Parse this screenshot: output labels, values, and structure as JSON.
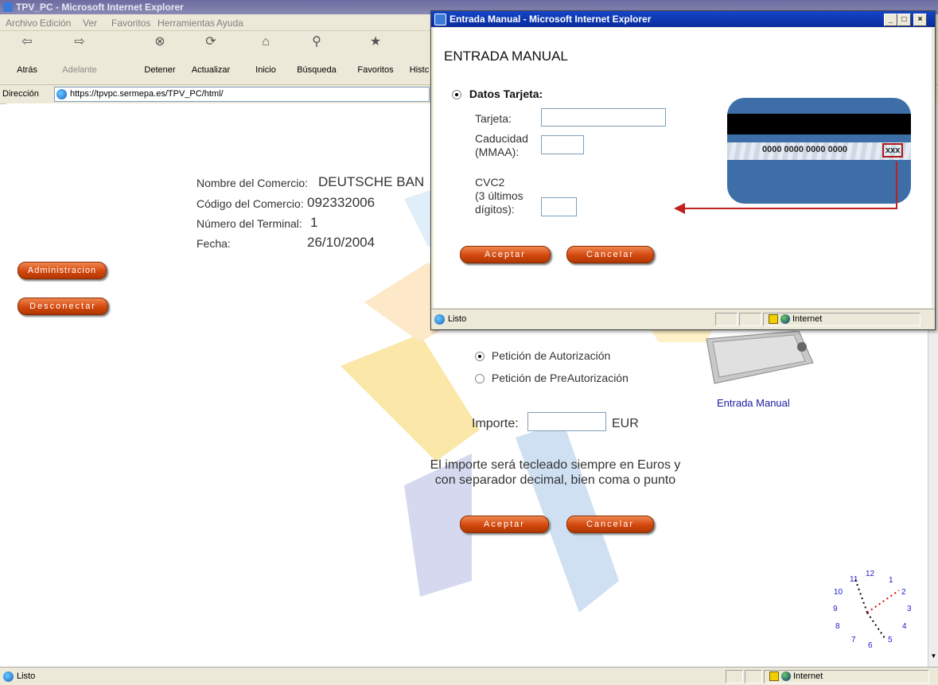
{
  "main_window": {
    "title": "TPV_PC - Microsoft Internet Explorer",
    "menu": [
      "Archivo",
      "Edición",
      "Ver",
      "Favoritos",
      "Herramientas",
      "Ayuda"
    ],
    "toolbar": {
      "back": "Atrás",
      "forward": "Adelante",
      "stop": "Detener",
      "refresh": "Actualizar",
      "home": "Inicio",
      "search": "Búsqueda",
      "favorites": "Favoritos",
      "history": "Histc"
    },
    "address_label": "Dirección",
    "address_url": "https://tpvpc.sermepa.es/TPV_PC/html/",
    "status_text": "Listo",
    "zone": "Internet"
  },
  "page": {
    "merchant_name_label": "Nombre del Comercio:",
    "merchant_name_value": "DEUTSCHE BAN",
    "merchant_code_label": "Código del Comercio:",
    "merchant_code_value": "092332006",
    "terminal_label": "Número del Terminal:",
    "terminal_value": "1",
    "date_label": "Fecha:",
    "date_value": "26/10/2004",
    "admin_button": "Administracion",
    "disconnect_button": "Desconectar",
    "radio_authorization": "Petición de Autorización",
    "radio_preauthorization": "Petición de PreAutorización",
    "amount_label": "Importe:",
    "amount_value": "",
    "currency": "EUR",
    "note_line1": "El importe será tecleado siempre en Euros y",
    "note_line2": "con separador decimal, bien coma o punto",
    "accept_button": "Aceptar",
    "cancel_button": "Cancelar",
    "manual_entry_link": "Entrada Manual",
    "clock_numbers": [
      "12",
      "1",
      "2",
      "3",
      "4",
      "5",
      "6",
      "7",
      "8",
      "9",
      "10",
      "11"
    ]
  },
  "popup": {
    "title": "Entrada Manual - Microsoft Internet Explorer",
    "heading": "ENTRADA MANUAL",
    "section_label": "Datos Tarjeta:",
    "card_label": "Tarjeta:",
    "expiry_label_1": "Caducidad",
    "expiry_label_2": "(MMAA):",
    "cvc_label_1": "CVC2",
    "cvc_label_2": "(3 últimos",
    "cvc_label_3": "dígitos):",
    "card_value": "",
    "expiry_value": "",
    "cvc_value": "",
    "card_number": "0000 0000 0000 0000",
    "card_cvc_mark": "xxx",
    "accept_button": "Aceptar",
    "cancel_button": "Cancelar",
    "status_text": "Listo",
    "zone": "Internet"
  },
  "colors": {
    "button_orange": "#d2480e",
    "card_blue": "#3d6ea8",
    "link_blue": "#1a1aa0",
    "clock_blue": "#1a1ad0",
    "arrow_red": "#c02020"
  }
}
